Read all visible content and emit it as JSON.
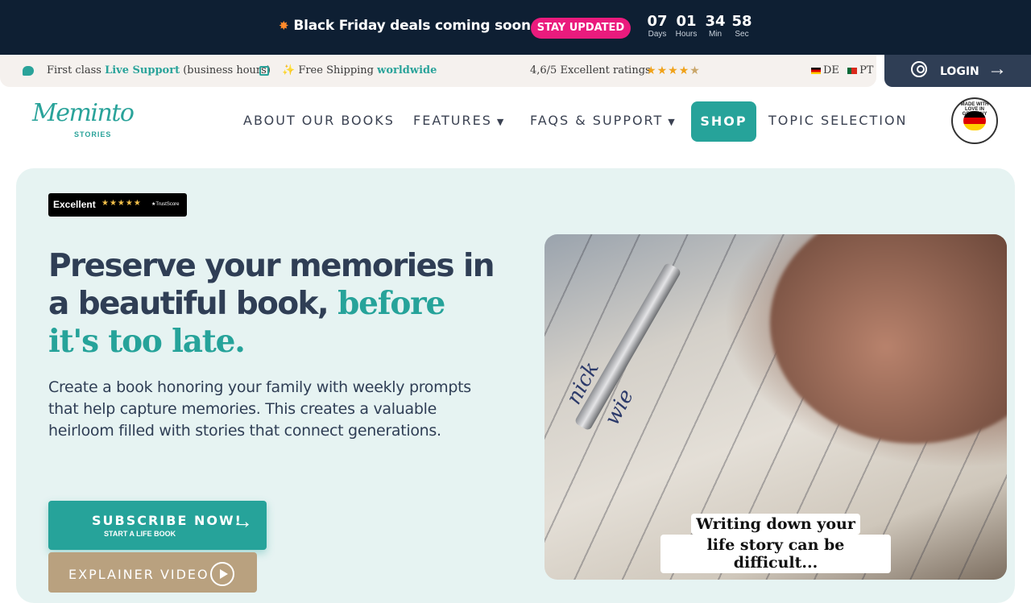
{
  "promo": {
    "message": "Black Friday deals coming soon...",
    "cta": "STAY UPDATED",
    "countdown": [
      {
        "num": "07",
        "label": "Days"
      },
      {
        "num": "01",
        "label": "Hours"
      },
      {
        "num": "34",
        "label": "Min"
      },
      {
        "num": "58",
        "label": "Sec"
      }
    ]
  },
  "infobar": {
    "support_prefix": "First class",
    "support_accent": "Live Support",
    "support_suffix": "(business hours)",
    "shipping_prefix": "✨ Free Shipping",
    "shipping_accent": "worldwide",
    "ratings": "4,6/5 Excellent ratings",
    "rating_value": 4.6,
    "lang_de": "DE",
    "lang_pt": "PT"
  },
  "login": {
    "label": "LOGIN"
  },
  "logo": {
    "name": "Meminto",
    "sub": "STORIES"
  },
  "nav": {
    "about": "ABOUT OUR BOOKS",
    "features": "FEATURES",
    "faqs": "FAQS & SUPPORT",
    "shop": "SHOP",
    "topics": "TOPIC SELECTION"
  },
  "badge": {
    "text": "MADE WITH LOVE IN GERMANY"
  },
  "trustpilot": {
    "label": "Excellent",
    "stars": "★★★★★",
    "brand": "★TrustScore"
  },
  "hero": {
    "headline_main": "Preserve your memories in a beautiful book, ",
    "headline_accent": "before it's too late.",
    "lead": "Create a book honoring your family with weekly prompts that help capture memories. This creates a valuable heirloom filled with stories that connect generations.",
    "subscribe": "SUBSCRIBE NOW!",
    "subscribe_sub": "START A LIFE BOOK",
    "video": "EXPLAINER VIDEO"
  },
  "photo": {
    "caption_line1": "Writing down your",
    "caption_line2": "life story can be difficult..."
  }
}
